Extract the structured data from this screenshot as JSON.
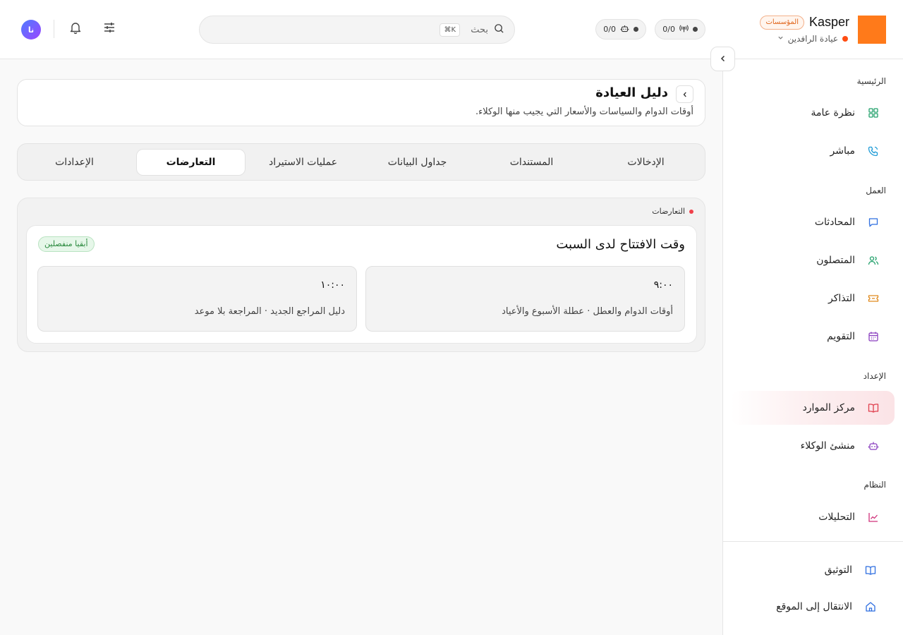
{
  "brand": {
    "name": "Kasper",
    "badge": "المؤسسات",
    "org_name": "عيادة الرافدين",
    "org_dot_color": "#ff4d12",
    "logo_color": "#ff7a1a"
  },
  "counters": [
    {
      "value": "0/0",
      "icon": "antenna-icon"
    },
    {
      "value": "0/0",
      "icon": "robot-icon"
    }
  ],
  "search": {
    "placeholder": "بحث",
    "shortcut": "⌘K"
  },
  "user": {
    "avatar_initials": "نا"
  },
  "sidebar": {
    "sections": {
      "home": "الرئيسية",
      "work": "العمل",
      "setup": "الإعداد",
      "system": "النظام"
    },
    "items": [
      {
        "label": "نظرة عامة",
        "icon": "grid-icon",
        "color": "#22a06b"
      },
      {
        "label": "مباشر",
        "icon": "phone-icon",
        "color": "#1e9bd7"
      },
      {
        "label": "المحادثات",
        "icon": "chat-icon",
        "color": "#2f6fe0"
      },
      {
        "label": "المتصلون",
        "icon": "users-icon",
        "color": "#22a06b"
      },
      {
        "label": "التذاكر",
        "icon": "ticket-icon",
        "color": "#e08a1e"
      },
      {
        "label": "التقويم",
        "icon": "calendar-icon",
        "color": "#8a3fbf"
      },
      {
        "label": "مركز الموارد",
        "icon": "book-icon",
        "color": "#e0404e",
        "active": true
      },
      {
        "label": "منشئ الوكلاء",
        "icon": "robot-icon",
        "color": "#8a3fbf"
      },
      {
        "label": "التحليلات",
        "icon": "chart-icon",
        "color": "#d0307a"
      }
    ],
    "footer": [
      {
        "label": "التوثيق",
        "icon": "docs-icon",
        "color": "#2f6fe0"
      },
      {
        "label": "الانتقال إلى الموقع",
        "icon": "home-icon",
        "color": "#2f6fe0"
      }
    ]
  },
  "page": {
    "title": "دليل العيادة",
    "subtitle": "أوقات الدوام والسياسات والأسعار التي يجيب منها الوكلاء."
  },
  "tabs": [
    {
      "label": "الإدخالات",
      "active": false
    },
    {
      "label": "المستندات",
      "active": false
    },
    {
      "label": "جداول البيانات",
      "active": false
    },
    {
      "label": "عمليات الاستيراد",
      "active": false
    },
    {
      "label": "التعارضات",
      "active": true
    },
    {
      "label": "الإعدادات",
      "active": false
    }
  ],
  "conflicts": {
    "panel_label": "التعارضات",
    "items": [
      {
        "title": "وقت الافتتاح لدى السبت",
        "status": "أبقيا منفصلين",
        "options": [
          {
            "value": "٩:٠٠",
            "source": "أوقات الدوام والعطل · عطلة الأسبوع والأعياد"
          },
          {
            "value": "١٠:٠٠",
            "source": "دليل المراجع الجديد · المراجعة بلا موعد"
          }
        ]
      }
    ]
  }
}
